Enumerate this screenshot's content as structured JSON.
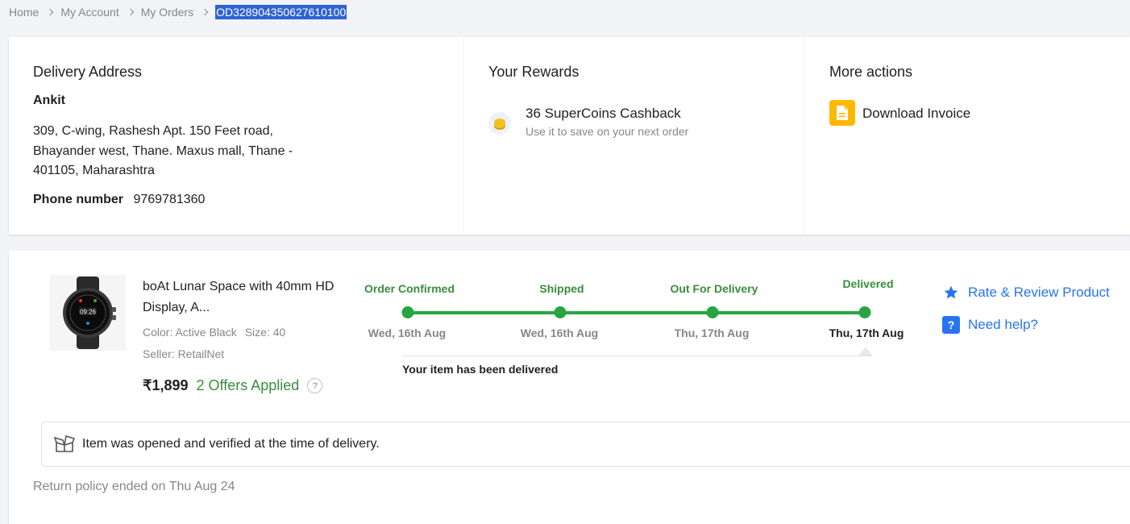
{
  "breadcrumb": {
    "items": [
      "Home",
      "My Account",
      "My Orders"
    ],
    "current": "OD328904350627610100"
  },
  "delivery": {
    "heading": "Delivery Address",
    "name": "Ankit",
    "address": "309, C-wing, Rashesh Apt. 150 Feet road, Bhayander west, Thane. Maxus mall, Thane - 401105, Maharashtra",
    "phone_label": "Phone number",
    "phone": "9769781360"
  },
  "rewards": {
    "heading": "Your Rewards",
    "title": "36 SuperCoins Cashback",
    "subtitle": "Use it to save on your next order",
    "icon": "supercoin-icon"
  },
  "more_actions": {
    "heading": "More actions",
    "invoice_label": "Download Invoice",
    "icon": "invoice-icon"
  },
  "product": {
    "name": "boAt Lunar Space with 40mm HD Display, A...",
    "color": "Color: Active Black",
    "size": "Size: 40",
    "seller": "Seller: RetailNet",
    "price": "₹1,899",
    "offers": "2 Offers Applied",
    "offer_help": "?"
  },
  "tracking": {
    "steps": [
      {
        "label": "Order Confirmed",
        "date": "Wed, 16th Aug"
      },
      {
        "label": "Shipped",
        "date": "Wed, 16th Aug"
      },
      {
        "label": "Out For Delivery",
        "date": "Thu, 17th Aug"
      },
      {
        "label": "Delivered",
        "date": "Thu, 17th Aug"
      }
    ],
    "status_message": "Your item has been delivered",
    "color": "#26a541"
  },
  "actions": {
    "rate": "Rate & Review Product",
    "help": "Need help?",
    "accent": "#2874f0"
  },
  "verification": {
    "text": "Item was opened and verified at the time of delivery.",
    "icon": "open-box-icon"
  },
  "return_policy": "Return policy ended on Thu Aug 24"
}
